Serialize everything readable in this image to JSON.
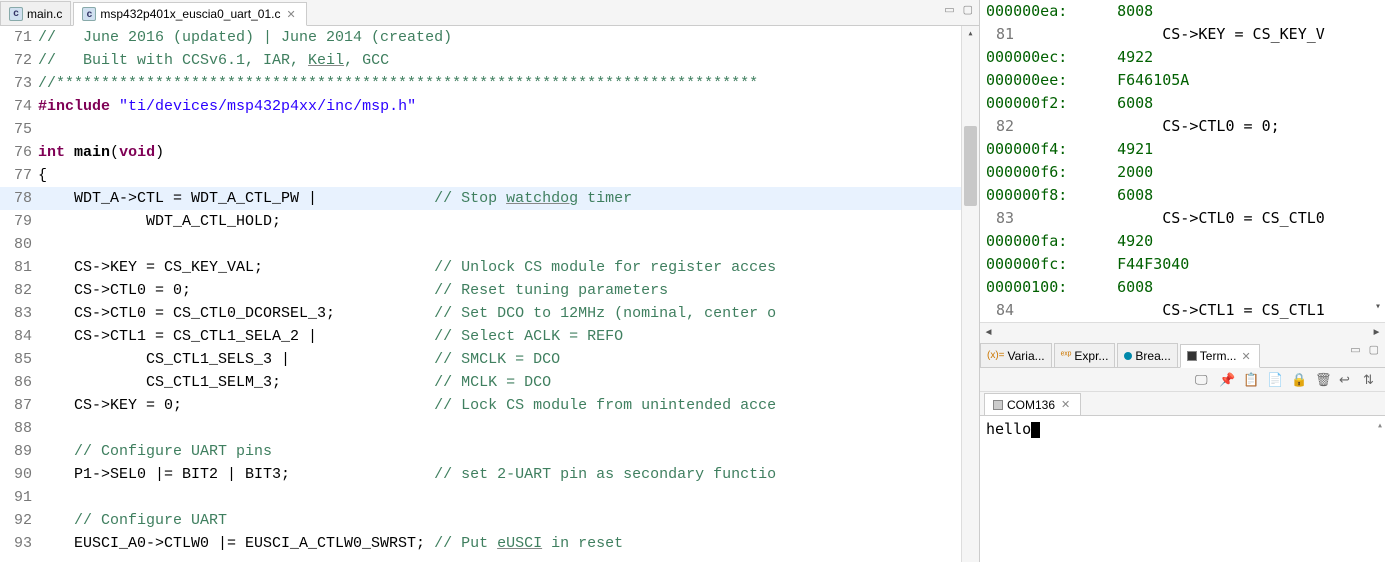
{
  "editor": {
    "tabs": [
      {
        "label": "main.c",
        "active": false
      },
      {
        "label": "msp432p401x_euscia0_uart_01.c",
        "active": true
      }
    ],
    "lines": [
      {
        "n": 71,
        "pre": "//   June 2016 (updated) | June 2014 (created)",
        "kind": "comment"
      },
      {
        "n": 72,
        "pre": "//   Built with CCSv6.1, IAR, Keil, GCC",
        "kind": "comment",
        "underline": [
          "Keil"
        ]
      },
      {
        "n": 73,
        "pre": "//******************************************************************************",
        "kind": "comment"
      },
      {
        "n": 74,
        "pre": "#include \"ti/devices/msp432p4xx/inc/msp.h\"",
        "kind": "include"
      },
      {
        "n": 75,
        "pre": "",
        "kind": "blank"
      },
      {
        "n": 76,
        "pre": "int main(void)",
        "kind": "funcdecl"
      },
      {
        "n": 77,
        "pre": "{",
        "kind": "plain"
      },
      {
        "n": 78,
        "pre": "    WDT_A->CTL = WDT_A_CTL_PW |             // Stop watchdog timer",
        "kind": "code-comment",
        "highlight": true,
        "underline": [
          "watchdog"
        ]
      },
      {
        "n": 79,
        "pre": "            WDT_A_CTL_HOLD;",
        "kind": "plain"
      },
      {
        "n": 80,
        "pre": "",
        "kind": "blank"
      },
      {
        "n": 81,
        "pre": "    CS->KEY = CS_KEY_VAL;                   // Unlock CS module for register acces",
        "kind": "code-comment"
      },
      {
        "n": 82,
        "pre": "    CS->CTL0 = 0;                           // Reset tuning parameters",
        "kind": "code-comment"
      },
      {
        "n": 83,
        "pre": "    CS->CTL0 = CS_CTL0_DCORSEL_3;           // Set DCO to 12MHz (nominal, center o",
        "kind": "code-comment"
      },
      {
        "n": 84,
        "pre": "    CS->CTL1 = CS_CTL1_SELA_2 |             // Select ACLK = REFO",
        "kind": "code-comment"
      },
      {
        "n": 85,
        "pre": "            CS_CTL1_SELS_3 |                // SMCLK = DCO",
        "kind": "code-comment"
      },
      {
        "n": 86,
        "pre": "            CS_CTL1_SELM_3;                 // MCLK = DCO",
        "kind": "code-comment"
      },
      {
        "n": 87,
        "pre": "    CS->KEY = 0;                            // Lock CS module from unintended acce",
        "kind": "code-comment"
      },
      {
        "n": 88,
        "pre": "",
        "kind": "blank"
      },
      {
        "n": 89,
        "pre": "    // Configure UART pins",
        "kind": "comment-indent"
      },
      {
        "n": 90,
        "pre": "    P1->SEL0 |= BIT2 | BIT3;                // set 2-UART pin as secondary functio",
        "kind": "code-comment"
      },
      {
        "n": 91,
        "pre": "",
        "kind": "blank"
      },
      {
        "n": 92,
        "pre": "    // Configure UART",
        "kind": "comment-indent"
      },
      {
        "n": 93,
        "pre": "    EUSCI_A0->CTLW0 |= EUSCI_A_CTLW0_SWRST; // Put eUSCI in reset",
        "kind": "code-comment",
        "underline": [
          "eUSCI"
        ]
      }
    ]
  },
  "disasm": {
    "lines": [
      {
        "addr": "000000ea:",
        "op": "8008",
        "green": true
      },
      {
        "srcnum": "81",
        "src": "        CS->KEY = CS_KEY_V"
      },
      {
        "addr": "000000ec:",
        "op": "4922",
        "green": true
      },
      {
        "addr": "000000ee:",
        "op": "F646105A",
        "green": true
      },
      {
        "addr": "000000f2:",
        "op": "6008",
        "green": true
      },
      {
        "srcnum": "82",
        "src": "        CS->CTL0 = 0;"
      },
      {
        "addr": "000000f4:",
        "op": "4921",
        "green": true
      },
      {
        "addr": "000000f6:",
        "op": "2000",
        "green": true
      },
      {
        "addr": "000000f8:",
        "op": "6008",
        "green": true
      },
      {
        "srcnum": "83",
        "src": "        CS->CTL0 = CS_CTL0"
      },
      {
        "addr": "000000fa:",
        "op": "4920",
        "green": true
      },
      {
        "addr": "000000fc:",
        "op": "F44F3040",
        "green": true
      },
      {
        "addr": "00000100:",
        "op": "6008",
        "green": true
      },
      {
        "srcnum": "84",
        "src": "        CS->CTL1 = CS_CTL1"
      }
    ]
  },
  "views": {
    "tabs": [
      {
        "label": "Varia...",
        "icon": "(x)="
      },
      {
        "label": "Expr...",
        "icon": "exp"
      },
      {
        "label": "Brea...",
        "icon": "brk"
      },
      {
        "label": "Term...",
        "icon": "term",
        "active": true
      }
    ]
  },
  "terminal": {
    "tab": "COM136",
    "content": "hello"
  }
}
